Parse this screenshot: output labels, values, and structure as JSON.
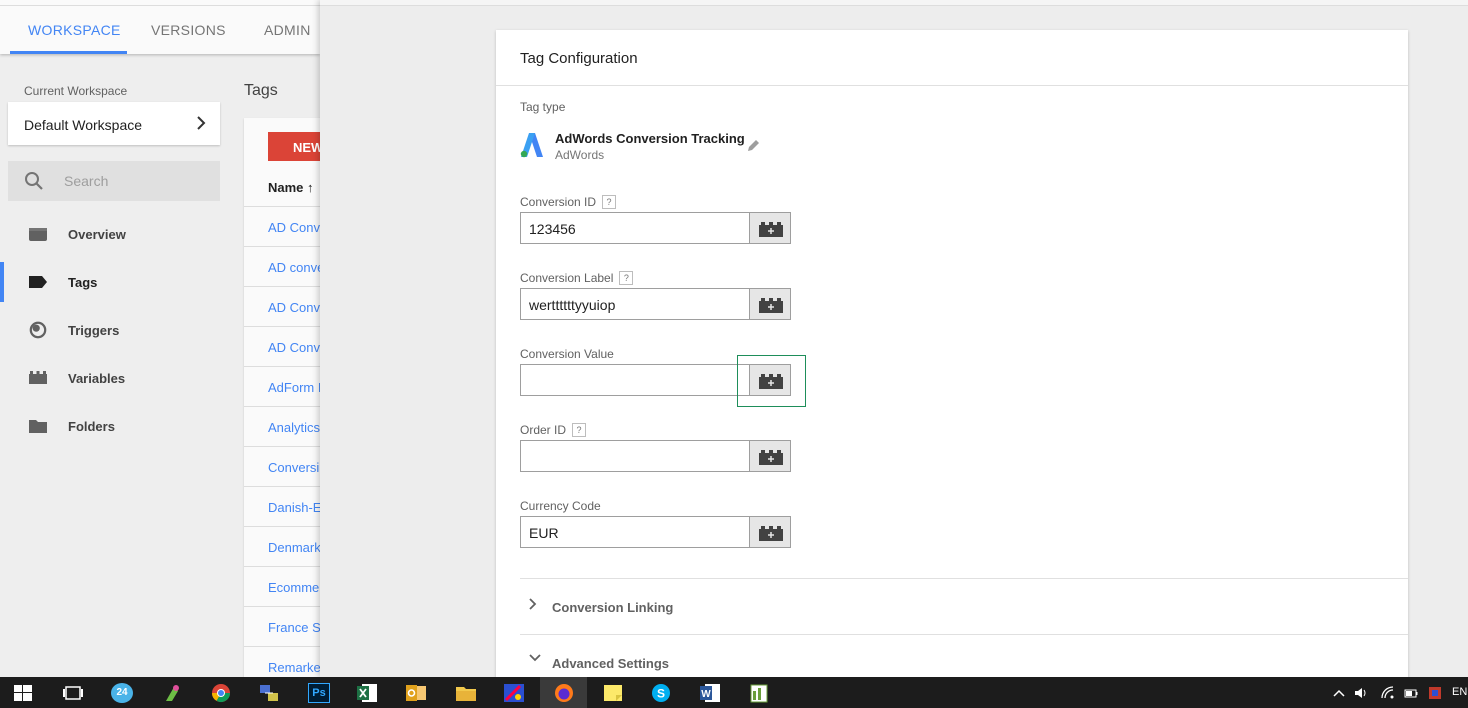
{
  "topnav": {
    "tabs": [
      "WORKSPACE",
      "VERSIONS",
      "ADMIN"
    ],
    "active_tab": "WORKSPACE"
  },
  "workspace": {
    "label": "Current Workspace",
    "name": "Default Workspace"
  },
  "search": {
    "placeholder": "Search"
  },
  "sidebar": {
    "items": [
      {
        "label": "Overview",
        "icon": "overview-icon"
      },
      {
        "label": "Tags",
        "icon": "tag-icon"
      },
      {
        "label": "Triggers",
        "icon": "trigger-icon"
      },
      {
        "label": "Variables",
        "icon": "variables-icon"
      },
      {
        "label": "Folders",
        "icon": "folder-icon"
      }
    ],
    "active": "Tags"
  },
  "tags": {
    "title": "Tags",
    "new_button": "NEW",
    "name_column": "Name",
    "rows": [
      "AD Conve",
      "AD conve",
      "AD Conve",
      "AD Conve",
      "AdForm I",
      "Analytics",
      "Conversi",
      "Danish-E",
      "Denmark",
      "Ecomme",
      "France S",
      "Remarket"
    ]
  },
  "config": {
    "title": "Tag Configuration",
    "tag_type_label": "Tag type",
    "tag_type_name": "AdWords Conversion Tracking",
    "tag_type_vendor": "AdWords",
    "help_glyph": "?",
    "fields": [
      {
        "label": "Conversion ID",
        "value": "123456",
        "help": true
      },
      {
        "label": "Conversion Label",
        "value": "werttttttyyuiop",
        "help": true
      },
      {
        "label": "Conversion Value",
        "value": "",
        "help": false
      },
      {
        "label": "Order ID",
        "value": "",
        "help": true
      },
      {
        "label": "Currency Code",
        "value": "EUR",
        "help": false
      }
    ],
    "sections": [
      {
        "label": "Conversion Linking",
        "expanded": false
      },
      {
        "label": "Advanced Settings",
        "expanded": true
      }
    ]
  },
  "taskbar": {
    "lang": "EN",
    "date_badge": "24"
  },
  "colors": {
    "accent": "#4285f4",
    "new_button": "#db4437",
    "focus_ring": "#1e8e5a"
  }
}
